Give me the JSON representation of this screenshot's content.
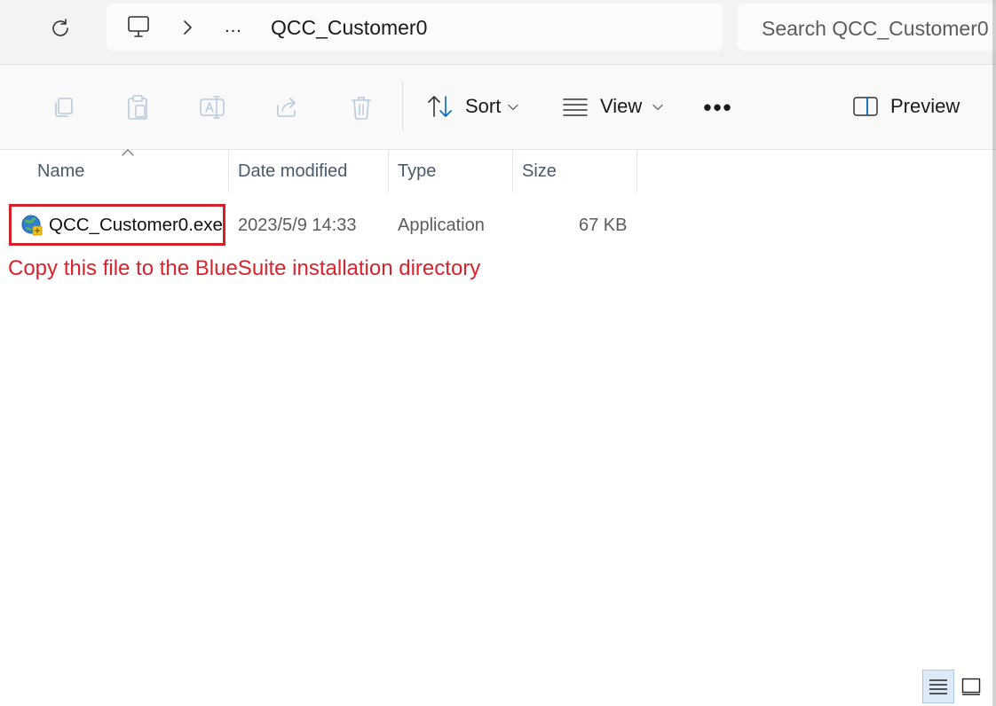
{
  "address": {
    "current_folder": "QCC_Customer0",
    "overflow_label": "...",
    "search_placeholder": "Search QCC_Customer0"
  },
  "toolbar": {
    "sort_label": "Sort",
    "view_label": "View",
    "more_label": "•••",
    "preview_label": "Preview"
  },
  "columns": {
    "name": "Name",
    "date": "Date modified",
    "type": "Type",
    "size": "Size"
  },
  "files": [
    {
      "name": "QCC_Customer0.exe",
      "date": "2023/5/9 14:33",
      "type": "Application",
      "size": "67 KB"
    }
  ],
  "annotation": {
    "text": "Copy this file to the BlueSuite installation directory",
    "color": "#d8232e"
  },
  "colors": {
    "highlight_border": "#d41f2a",
    "accent": "#0067c0"
  }
}
